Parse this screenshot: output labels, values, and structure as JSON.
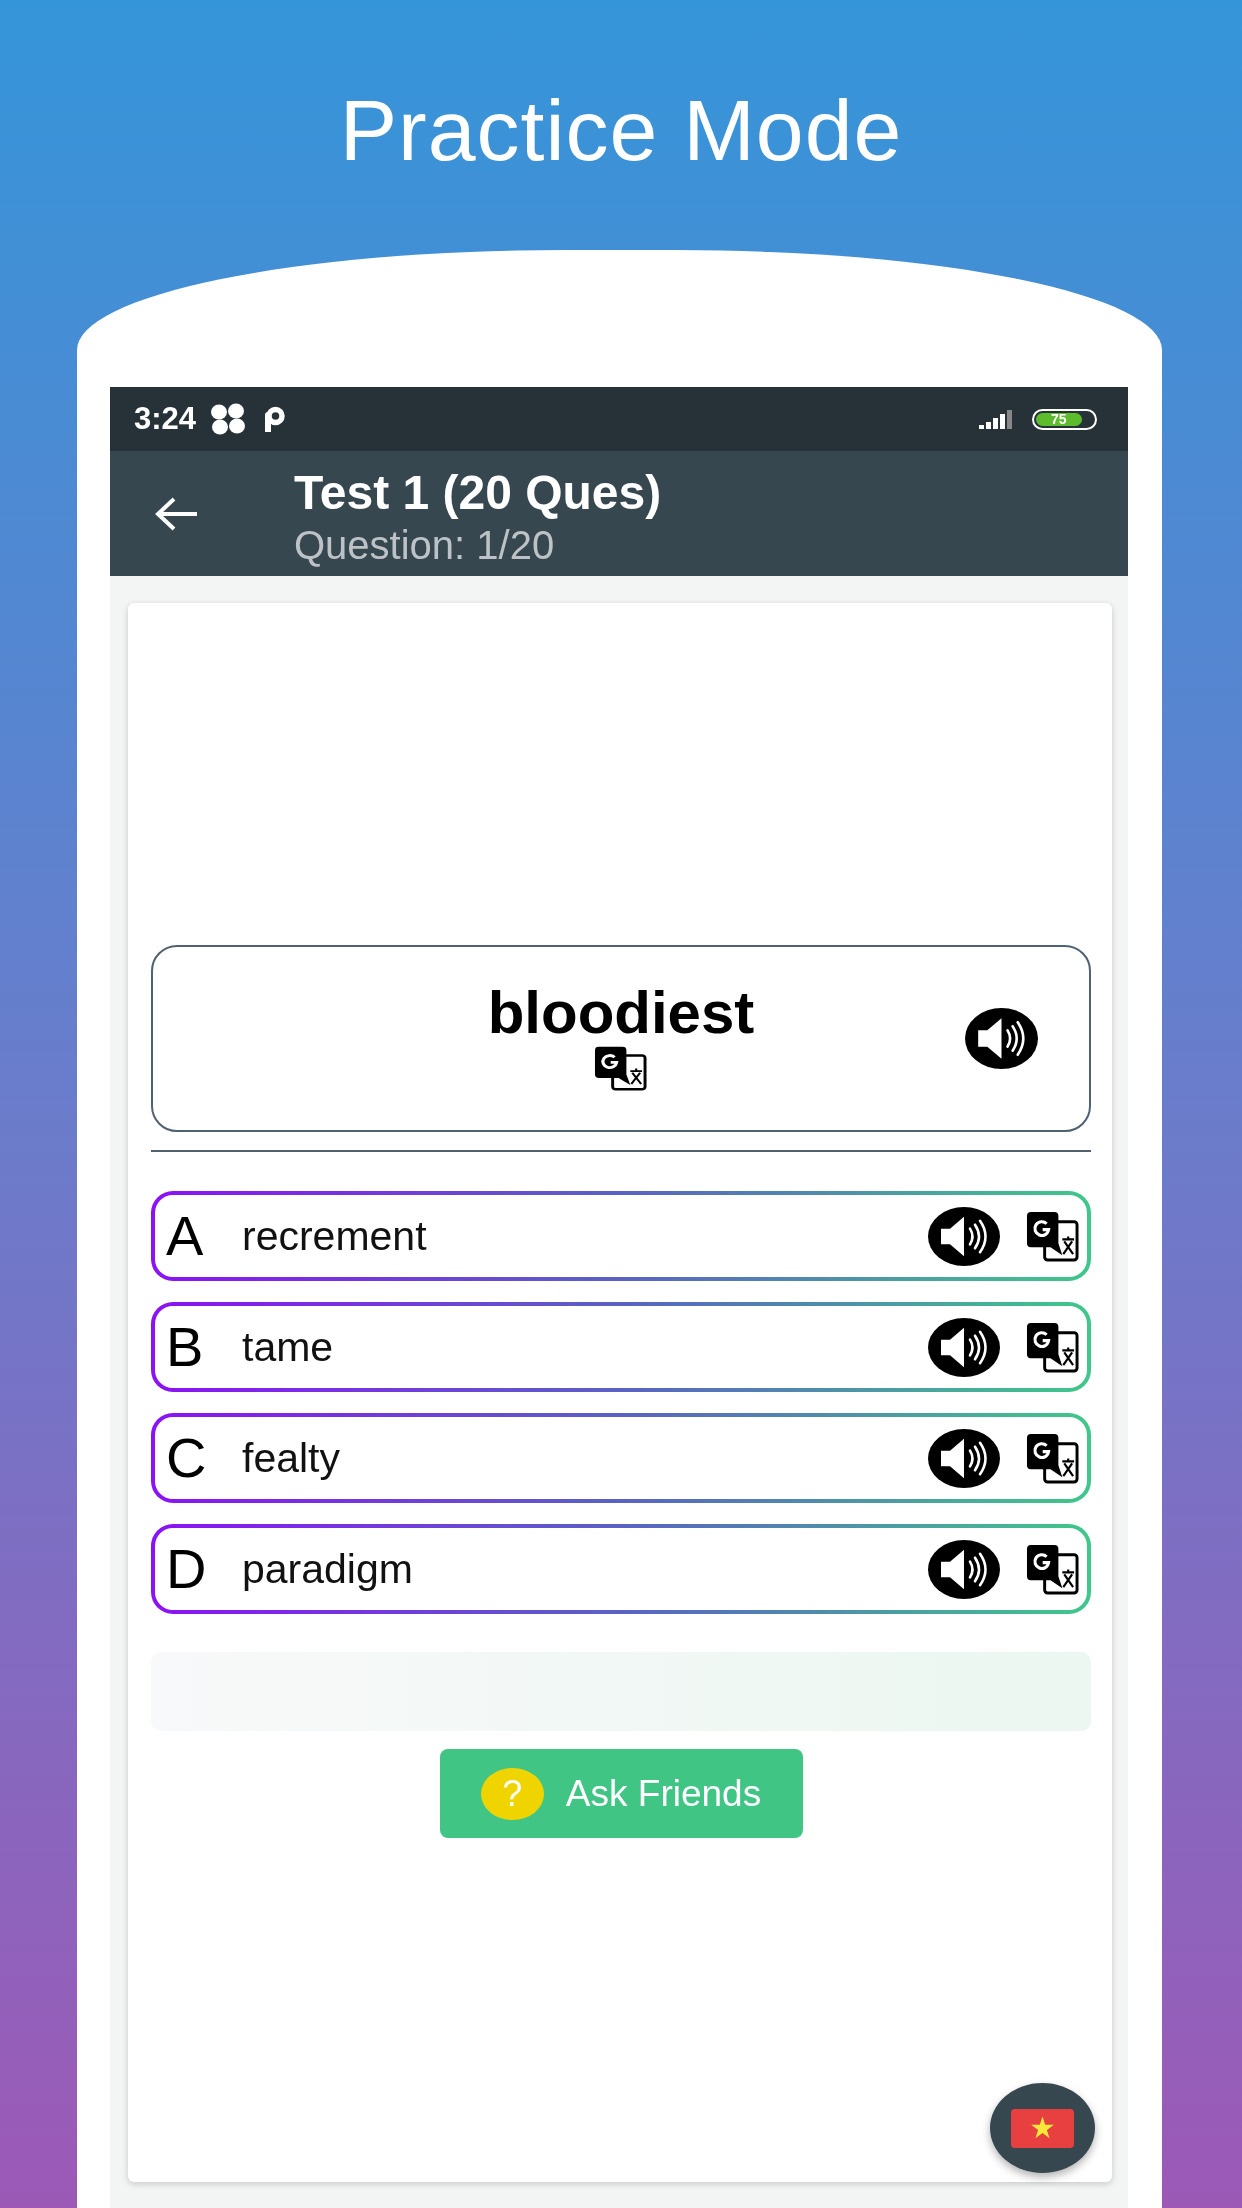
{
  "header": {
    "title": "Practice Mode"
  },
  "status_bar": {
    "time": "3:24",
    "battery": "75"
  },
  "app_bar": {
    "title": "Test 1 (20 Ques)",
    "subtitle": "Question: 1/20"
  },
  "question": {
    "word": "bloodiest"
  },
  "options": [
    {
      "letter": "A",
      "text": "recrement",
      "selected": false
    },
    {
      "letter": "B",
      "text": "tame",
      "selected": false
    },
    {
      "letter": "C",
      "text": "fealty",
      "selected": false
    },
    {
      "letter": "D",
      "text": "paradigm",
      "selected": false
    }
  ],
  "ask_button": {
    "icon": "?",
    "label": "Ask Friends"
  }
}
